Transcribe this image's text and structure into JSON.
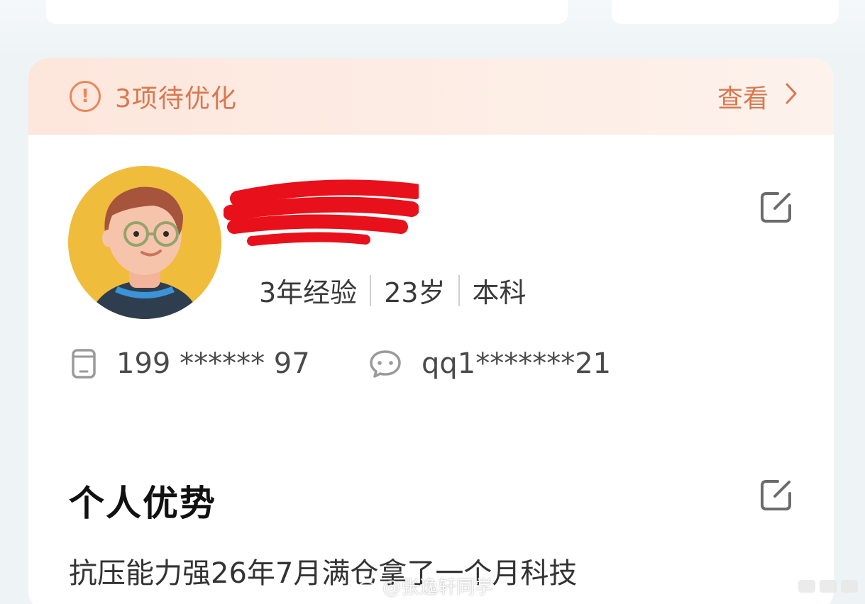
{
  "banner": {
    "alert_icon": "exclamation-circle-icon",
    "text": "3项待优化",
    "link_label": "查看",
    "link_icon": "chevron-right-icon"
  },
  "profile": {
    "avatar_icon": "avatar-illustration",
    "meta": [
      "3年经验",
      "23岁",
      "本科"
    ],
    "phone_icon": "phone-icon",
    "phone": "199 ****** 97",
    "wechat_icon": "wechat-icon",
    "wechat": "qq1*******21",
    "edit_icon": "edit-icon"
  },
  "advantage": {
    "title": "个人优势",
    "edit_icon": "edit-icon",
    "text": "抗压能力强26年7月满仓拿了一个月科技"
  },
  "watermark": {
    "text": "@张逸轩同学"
  },
  "colors": {
    "accent": "#d9784f",
    "banner_bg": "#fde6dc",
    "avatar_bg": "#f0bc3c"
  }
}
